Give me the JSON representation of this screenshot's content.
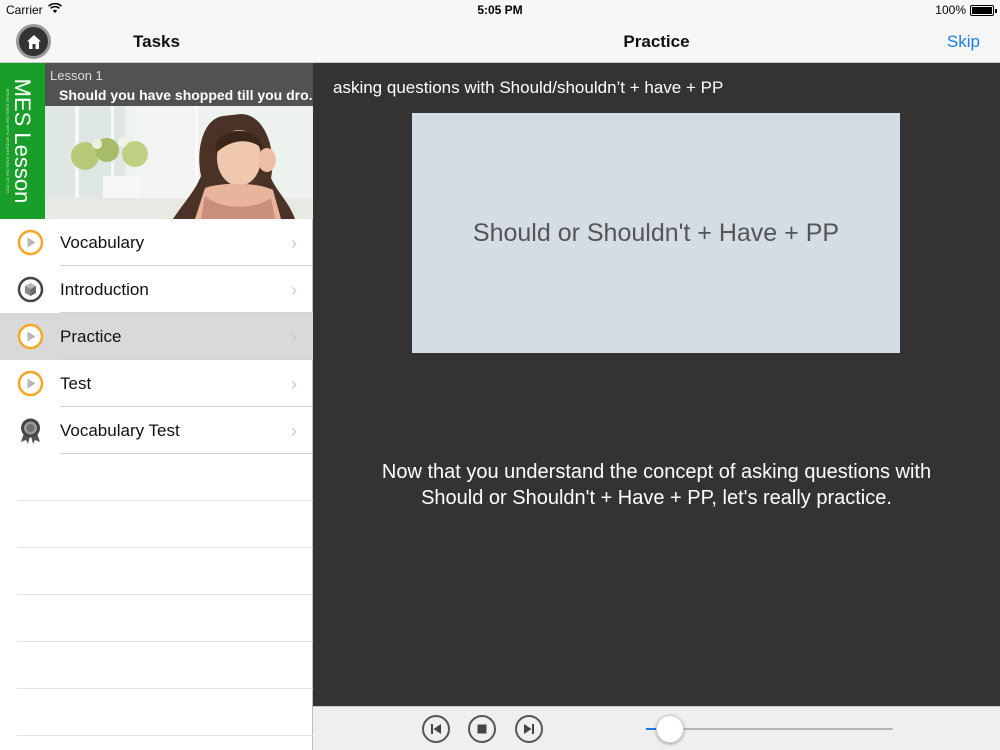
{
  "status_bar": {
    "carrier": "Carrier",
    "time": "5:05 PM",
    "battery": "100%"
  },
  "left": {
    "nav_title": "Tasks",
    "banner": {
      "brand": "MES Lesson",
      "brand_small": "SPEAK ENGLISH WITH MODERN ENGLISH STUDIO",
      "lesson": "Lesson 1",
      "lesson_title": "Should you have shopped till you dro..."
    },
    "tasks": [
      {
        "label": "Vocabulary",
        "icon": "play-circle-icon",
        "selected": false
      },
      {
        "label": "Introduction",
        "icon": "cube-icon",
        "selected": false
      },
      {
        "label": "Practice",
        "icon": "play-circle-icon",
        "selected": true
      },
      {
        "label": "Test",
        "icon": "play-circle-icon",
        "selected": false
      },
      {
        "label": "Vocabulary Test",
        "icon": "medal-icon",
        "selected": false
      }
    ]
  },
  "right": {
    "nav_title": "Practice",
    "skip_label": "Skip",
    "subtitle": "asking questions with Should/shouldn’t + have + PP",
    "slide_text": "Should or Shouldn't + Have + PP",
    "caption": "Now that you understand the concept of asking questions with Should or Shouldn't + Have + PP, let's really practice.",
    "progress": 0.04
  },
  "colors": {
    "accent": "#1a7de6",
    "brand_green": "#1a9e2a",
    "play_orange": "#f5a623",
    "stage_bg": "#333333"
  }
}
